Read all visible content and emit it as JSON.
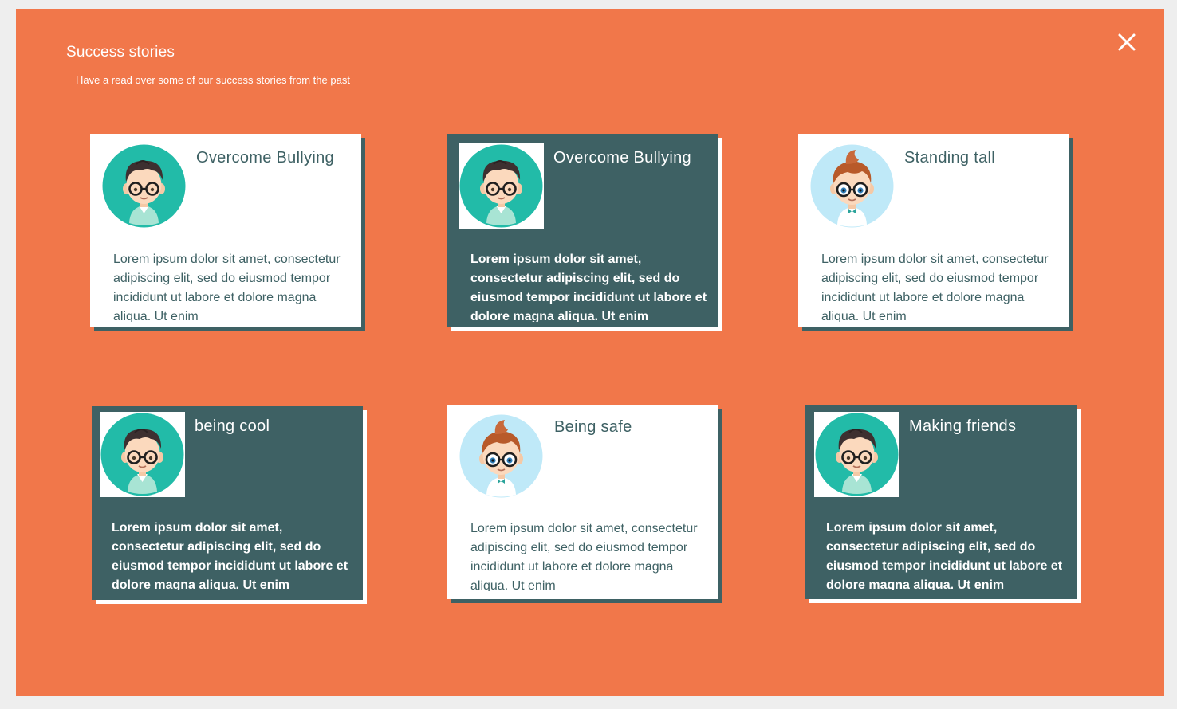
{
  "header": {
    "title": "Success stories",
    "subtitle": "Have a read over some of our success stories from the past",
    "close_icon": "close-icon"
  },
  "colors": {
    "background": "#f1774a",
    "dark_card": "#3e6164",
    "light_card": "#ffffff",
    "avatar_teal": "#22bba8",
    "avatar_light_blue": "#bfe9f8"
  },
  "stories": [
    {
      "name": "Overcome Bullying",
      "body": "Lorem ipsum dolor sit amet, consectetur adipiscing elit, sed do eiusmod tempor incididunt ut labore et dolore magna aliqua. Ut enim",
      "theme": "light",
      "avatar": "boy-dark-hair-avatar-icon"
    },
    {
      "name": "Overcome Bullying",
      "body": "Lorem ipsum dolor sit amet, consectetur adipiscing elit, sed do eiusmod tempor incididunt ut labore et dolore magna aliqua. Ut enim",
      "theme": "dark",
      "avatar": "boy-dark-hair-avatar-icon"
    },
    {
      "name": "Standing tall",
      "body": "Lorem ipsum dolor sit amet, consectetur adipiscing elit, sed do eiusmod tempor incididunt ut labore et dolore magna aliqua. Ut enim",
      "theme": "light",
      "avatar": "boy-red-hair-avatar-icon"
    },
    {
      "name": "being cool",
      "body": "Lorem ipsum dolor sit amet, consectetur adipiscing elit, sed do eiusmod tempor incididunt ut labore et dolore magna aliqua. Ut enim",
      "theme": "dark",
      "avatar": "boy-dark-hair-avatar-icon"
    },
    {
      "name": "Being safe",
      "body": "Lorem ipsum dolor sit amet, consectetur adipiscing elit, sed do eiusmod tempor incididunt ut labore et dolore magna aliqua. Ut enim",
      "theme": "light",
      "avatar": "boy-red-hair-avatar-icon"
    },
    {
      "name": "Making friends",
      "body": "Lorem ipsum dolor sit amet, consectetur adipiscing elit, sed do eiusmod tempor incididunt ut labore et dolore magna aliqua. Ut enim",
      "theme": "dark",
      "avatar": "boy-dark-hair-avatar-icon"
    }
  ]
}
